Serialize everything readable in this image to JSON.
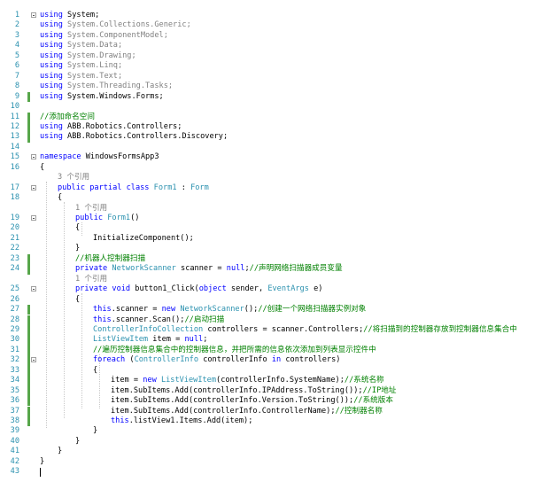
{
  "colors": {
    "keyword": "#0000ff",
    "type": "#2b91af",
    "comment": "#008000",
    "line_number": "#2b91af",
    "reference_hint": "#808080",
    "change_marker": "#57a64a"
  },
  "editor": {
    "lines": [
      {
        "n": "1",
        "indent": 0,
        "tokens": [
          [
            "kw",
            "using"
          ],
          [
            "ns",
            " System;"
          ]
        ]
      },
      {
        "n": "2",
        "indent": 0,
        "tokens": [
          [
            "kw",
            "using"
          ],
          [
            "gy",
            " System.Collections.Generic;"
          ]
        ]
      },
      {
        "n": "3",
        "indent": 0,
        "tokens": [
          [
            "kw",
            "using"
          ],
          [
            "gy",
            " System.ComponentModel;"
          ]
        ]
      },
      {
        "n": "4",
        "indent": 0,
        "tokens": [
          [
            "kw",
            "using"
          ],
          [
            "gy",
            " System.Data;"
          ]
        ]
      },
      {
        "n": "5",
        "indent": 0,
        "tokens": [
          [
            "kw",
            "using"
          ],
          [
            "gy",
            " System.Drawing;"
          ]
        ]
      },
      {
        "n": "6",
        "indent": 0,
        "tokens": [
          [
            "kw",
            "using"
          ],
          [
            "gy",
            " System.Linq;"
          ]
        ]
      },
      {
        "n": "7",
        "indent": 0,
        "tokens": [
          [
            "kw",
            "using"
          ],
          [
            "gy",
            " System.Text;"
          ]
        ]
      },
      {
        "n": "8",
        "indent": 0,
        "tokens": [
          [
            "kw",
            "using"
          ],
          [
            "gy",
            " System.Threading.Tasks;"
          ]
        ]
      },
      {
        "n": "9",
        "indent": 0,
        "tokens": [
          [
            "kw",
            "using"
          ],
          [
            "ns",
            " System.Windows.Forms;"
          ]
        ]
      },
      {
        "n": "10",
        "indent": 0,
        "tokens": []
      },
      {
        "n": "11",
        "indent": 0,
        "tokens": [
          [
            "cm",
            "//添加命名空间"
          ]
        ]
      },
      {
        "n": "12",
        "indent": 0,
        "tokens": [
          [
            "kw",
            "using"
          ],
          [
            "ns",
            " ABB.Robotics.Controllers;"
          ]
        ]
      },
      {
        "n": "13",
        "indent": 0,
        "tokens": [
          [
            "kw",
            "using"
          ],
          [
            "ns",
            " ABB.Robotics.Controllers.Discovery;"
          ]
        ]
      },
      {
        "n": "14",
        "indent": 0,
        "tokens": []
      },
      {
        "n": "15",
        "indent": 0,
        "tokens": [
          [
            "kw",
            "namespace"
          ],
          [
            "ns",
            " WindowsFormsApp3"
          ]
        ]
      },
      {
        "n": "16",
        "indent": 0,
        "tokens": [
          [
            "ns",
            "{"
          ]
        ]
      },
      {
        "n": "",
        "indent": 1,
        "tokens": [
          [
            "rf",
            "3 个引用"
          ]
        ]
      },
      {
        "n": "17",
        "indent": 1,
        "tokens": [
          [
            "kw",
            "public partial class"
          ],
          [
            "ns",
            " "
          ],
          [
            "ty",
            "Form1"
          ],
          [
            "ns",
            " : "
          ],
          [
            "ty",
            "Form"
          ]
        ]
      },
      {
        "n": "18",
        "indent": 1,
        "tokens": [
          [
            "ns",
            "{"
          ]
        ]
      },
      {
        "n": "",
        "indent": 2,
        "tokens": [
          [
            "rf",
            "1 个引用"
          ]
        ]
      },
      {
        "n": "19",
        "indent": 2,
        "tokens": [
          [
            "kw",
            "public"
          ],
          [
            "ns",
            " "
          ],
          [
            "ty",
            "Form1"
          ],
          [
            "ns",
            "()"
          ]
        ]
      },
      {
        "n": "20",
        "indent": 2,
        "tokens": [
          [
            "ns",
            "{"
          ]
        ]
      },
      {
        "n": "21",
        "indent": 3,
        "tokens": [
          [
            "ns",
            "InitializeComponent();"
          ]
        ]
      },
      {
        "n": "22",
        "indent": 2,
        "tokens": [
          [
            "ns",
            "}"
          ]
        ]
      },
      {
        "n": "23",
        "indent": 2,
        "tokens": [
          [
            "cm",
            "//机器人控制器扫描"
          ]
        ]
      },
      {
        "n": "24",
        "indent": 2,
        "tokens": [
          [
            "kw",
            "private"
          ],
          [
            "ns",
            " "
          ],
          [
            "ty",
            "NetworkScanner"
          ],
          [
            "ns",
            " scanner = "
          ],
          [
            "kw",
            "null"
          ],
          [
            "ns",
            ";"
          ],
          [
            "cm",
            "//声明网络扫描器成员变量"
          ]
        ]
      },
      {
        "n": "",
        "indent": 2,
        "tokens": [
          [
            "rf",
            "1 个引用"
          ]
        ]
      },
      {
        "n": "25",
        "indent": 2,
        "tokens": [
          [
            "kw",
            "private void"
          ],
          [
            "ns",
            " button1_Click("
          ],
          [
            "kw",
            "object"
          ],
          [
            "ns",
            " sender, "
          ],
          [
            "ty",
            "EventArgs"
          ],
          [
            "ns",
            " e)"
          ]
        ]
      },
      {
        "n": "26",
        "indent": 2,
        "tokens": [
          [
            "ns",
            "{"
          ]
        ]
      },
      {
        "n": "27",
        "indent": 3,
        "tokens": [
          [
            "kw",
            "this"
          ],
          [
            "ns",
            ".scanner = "
          ],
          [
            "kw",
            "new"
          ],
          [
            "ns",
            " "
          ],
          [
            "ty",
            "NetworkScanner"
          ],
          [
            "ns",
            "();"
          ],
          [
            "cm",
            "//创建一个网络扫描器实例对象"
          ]
        ]
      },
      {
        "n": "28",
        "indent": 3,
        "tokens": [
          [
            "kw",
            "this"
          ],
          [
            "ns",
            ".scanner.Scan();"
          ],
          [
            "cm",
            "//启动扫描"
          ]
        ]
      },
      {
        "n": "29",
        "indent": 3,
        "tokens": [
          [
            "ty",
            "ControllerInfoCollection"
          ],
          [
            "ns",
            " controllers = scanner.Controllers;"
          ],
          [
            "cm",
            "//将扫描到的控制器存放到控制器信息集合中"
          ]
        ]
      },
      {
        "n": "30",
        "indent": 3,
        "tokens": [
          [
            "ty",
            "ListViewItem"
          ],
          [
            "ns",
            " item = "
          ],
          [
            "kw",
            "null"
          ],
          [
            "ns",
            ";"
          ]
        ]
      },
      {
        "n": "31",
        "indent": 3,
        "tokens": [
          [
            "cm",
            "//遍历控制器信息集合中的控制器信息，并把所需的信息依次添加到列表显示控件中"
          ]
        ]
      },
      {
        "n": "32",
        "indent": 3,
        "tokens": [
          [
            "kw",
            "foreach"
          ],
          [
            "ns",
            " ("
          ],
          [
            "ty",
            "ControllerInfo"
          ],
          [
            "ns",
            " controllerInfo "
          ],
          [
            "kw",
            "in"
          ],
          [
            "ns",
            " controllers)"
          ]
        ]
      },
      {
        "n": "33",
        "indent": 3,
        "tokens": [
          [
            "ns",
            "{"
          ]
        ]
      },
      {
        "n": "34",
        "indent": 4,
        "tokens": [
          [
            "ns",
            "item = "
          ],
          [
            "kw",
            "new"
          ],
          [
            "ns",
            " "
          ],
          [
            "ty",
            "ListViewItem"
          ],
          [
            "ns",
            "(controllerInfo.SystemName);"
          ],
          [
            "cm",
            "//系统名称"
          ]
        ]
      },
      {
        "n": "35",
        "indent": 4,
        "tokens": [
          [
            "ns",
            "item.SubItems.Add(controllerInfo.IPAddress.ToString());"
          ],
          [
            "cm",
            "//IP地址"
          ]
        ]
      },
      {
        "n": "36",
        "indent": 4,
        "tokens": [
          [
            "ns",
            "item.SubItems.Add(controllerInfo.Version.ToString());"
          ],
          [
            "cm",
            "//系统版本"
          ]
        ]
      },
      {
        "n": "37",
        "indent": 4,
        "tokens": [
          [
            "ns",
            "item.SubItems.Add(controllerInfo.ControllerName);"
          ],
          [
            "cm",
            "//控制器名称"
          ]
        ]
      },
      {
        "n": "38",
        "indent": 4,
        "tokens": [
          [
            "kw",
            "this"
          ],
          [
            "ns",
            ".listView1.Items.Add(item);"
          ]
        ]
      },
      {
        "n": "39",
        "indent": 3,
        "tokens": [
          [
            "ns",
            "}"
          ]
        ]
      },
      {
        "n": "40",
        "indent": 2,
        "tokens": [
          [
            "ns",
            "}"
          ]
        ]
      },
      {
        "n": "41",
        "indent": 1,
        "tokens": [
          [
            "ns",
            "}"
          ]
        ]
      },
      {
        "n": "42",
        "indent": 0,
        "tokens": [
          [
            "ns",
            "}"
          ]
        ]
      },
      {
        "n": "43",
        "indent": 0,
        "tokens": []
      }
    ],
    "change_marked_lines": [
      "9",
      "11",
      "12",
      "13",
      "23",
      "24",
      "27",
      "28",
      "29",
      "30",
      "31",
      "32",
      "33",
      "34",
      "35",
      "36",
      "37",
      "38"
    ],
    "fold_lines": [
      "1",
      "15",
      "17",
      "19",
      "25",
      "32"
    ]
  }
}
